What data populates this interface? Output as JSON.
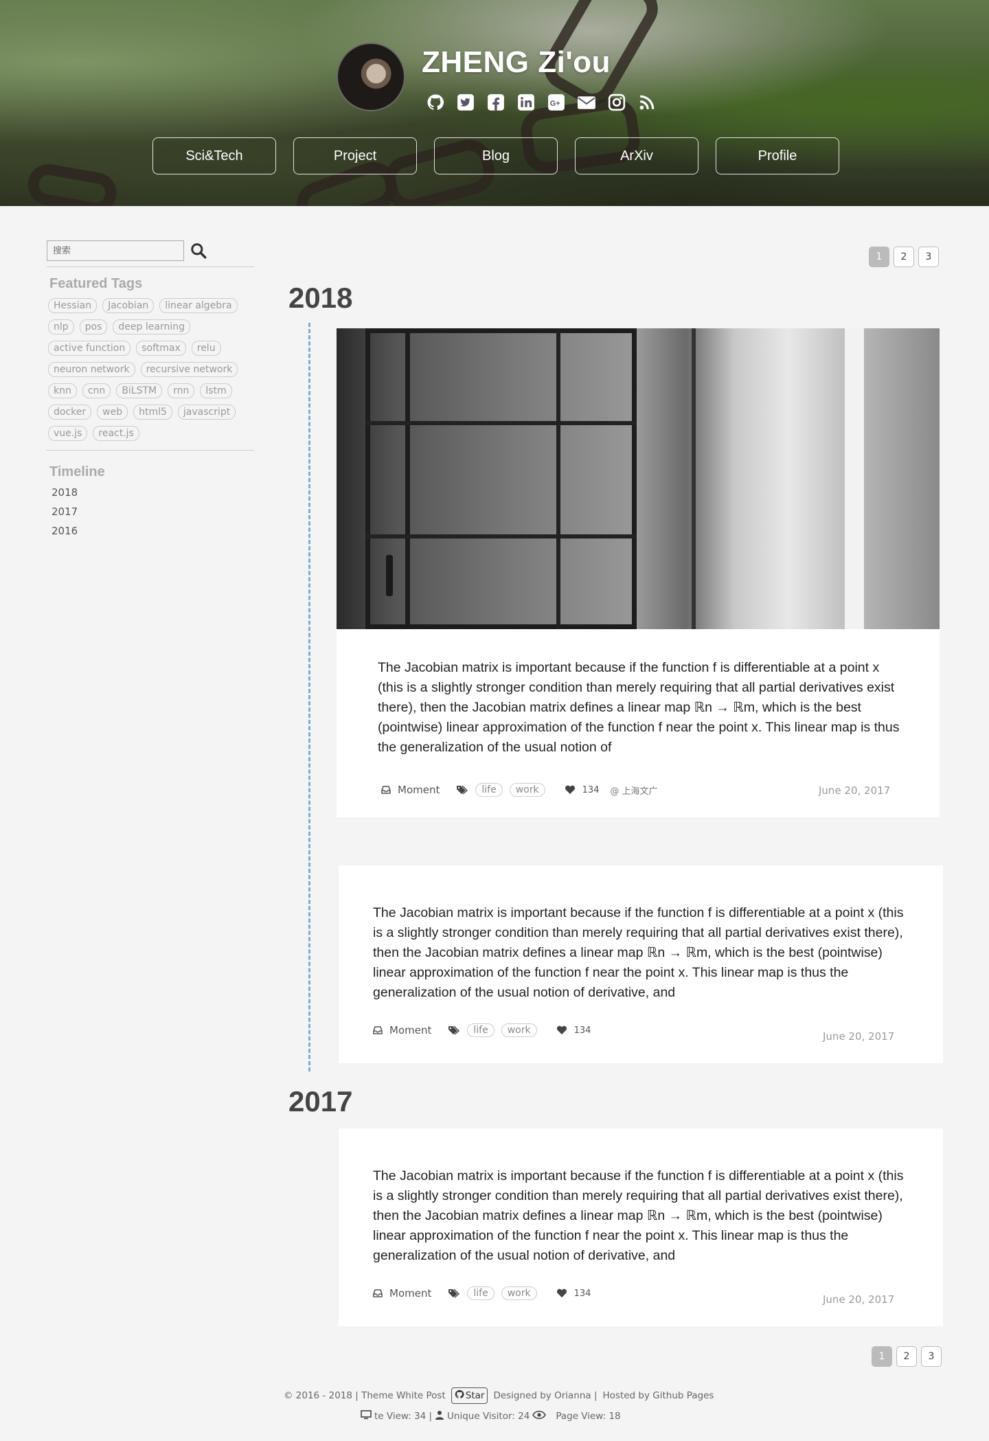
{
  "header": {
    "title": "ZHENG Zi'ou",
    "social_icons": [
      "github-icon",
      "twitter-icon",
      "facebook-icon",
      "linkedin-icon",
      "google-plus-icon",
      "email-icon",
      "instagram-icon",
      "rss-icon"
    ],
    "nav": [
      "Sci&Tech",
      "Project",
      "Blog",
      "ArXiv",
      "Profile"
    ]
  },
  "sidebar": {
    "search_placeholder": "搜索",
    "featured_tags_heading": "Featured Tags",
    "tags": [
      "Hessian",
      "Jacobian",
      "linear algebra",
      "nlp",
      "pos",
      "deep learning",
      "active function",
      "softmax",
      "relu",
      "neuron network",
      "recursive network",
      "knn",
      "cnn",
      "BiLSTM",
      "rnn",
      "lstm",
      "docker",
      "web",
      "html5",
      "javascript",
      "vue.js",
      "react.js"
    ],
    "timeline_heading": "Timeline",
    "timeline": [
      "2018",
      "2017",
      "2016"
    ]
  },
  "pagination": [
    "1",
    "2",
    "3"
  ],
  "pagination_active": "1",
  "sections": [
    {
      "year": "2018",
      "posts": [
        {
          "has_image": true,
          "text": "The Jacobian matrix is important because if the function f is differentiable at a point x (this is a slightly stronger condition than merely requiring that all partial derivatives exist there), then the Jacobian matrix defines a linear map ℝn → ℝm, which is the best (pointwise) linear approximation of the function f near the point x. This linear map is thus the generalization of the usual notion of",
          "category": "Moment",
          "tags": [
            "life",
            "work"
          ],
          "likes": "134",
          "location": "@ 上海文广",
          "date": "June 20, 2017"
        },
        {
          "has_image": false,
          "text": "The Jacobian matrix is important because if the function f is differentiable at a point x (this is a slightly stronger condition than merely requiring that all partial derivatives exist there), then the Jacobian matrix defines a linear map ℝn → ℝm, which is the best (pointwise) linear approximation of the function f near the point x. This linear map is thus the generalization of the usual notion of derivative, and",
          "category": "Moment",
          "tags": [
            "life",
            "work"
          ],
          "likes": "134",
          "date": "June 20, 2017"
        }
      ]
    },
    {
      "year": "2017",
      "posts": [
        {
          "has_image": false,
          "text": "The Jacobian matrix is important because if the function f is differentiable at a point x (this is a slightly stronger condition than merely requiring that all partial derivatives exist there), then the Jacobian matrix defines a linear map ℝn → ℝm, which is the best (pointwise) linear approximation of the function f near the point x. This linear map is thus the generalization of the usual notion of derivative, and",
          "category": "Moment",
          "tags": [
            "life",
            "work"
          ],
          "likes": "134",
          "date": "June 20, 2017"
        }
      ]
    }
  ],
  "footer": {
    "copyright": "© 2016 - 2018 | Theme White Post",
    "star_label": "Star",
    "designed_by": "Designed by Orianna |",
    "hosted_by": "Hosted by Github Pages",
    "site_view": "te View: 34 |",
    "unique_visitor": "Unique Visitor: 24",
    "page_view": "Page View: 18"
  },
  "colors": {
    "timeline_line": "#7aaed6",
    "page_bg": "#f4f4f4",
    "active_page": "#bbbbbb"
  }
}
